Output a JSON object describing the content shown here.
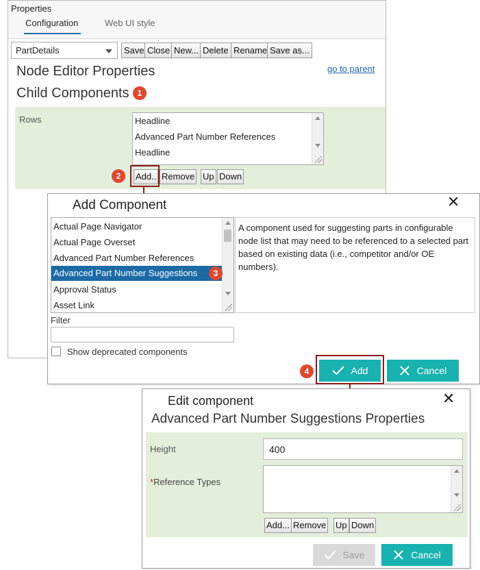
{
  "properties": {
    "title": "Properties",
    "tabs": [
      {
        "label": "Configuration",
        "active": true
      },
      {
        "label": "Web UI style",
        "active": false
      }
    ],
    "toolbar": {
      "select_value": "PartDetails",
      "buttons": [
        "Save",
        "Close",
        "New...",
        "Delete",
        "Rename",
        "Save as..."
      ]
    },
    "heading": "Node Editor Properties",
    "goto_parent": "go to parent",
    "child_heading": "Child Components",
    "rows": {
      "label": "Rows",
      "items": [
        "Headline",
        "Advanced Part Number References",
        "Headline"
      ],
      "buttons": [
        "Add..",
        "Remove",
        "Up",
        "Down"
      ]
    }
  },
  "markers": [
    "1",
    "2",
    "3",
    "4"
  ],
  "add_dialog": {
    "title": "Add Component",
    "close_icon": "close-icon",
    "components": [
      "Actual Page Navigator",
      "Actual Page Overset",
      "Advanced Part Number References",
      "Advanced Part Number Suggestions",
      "Approval Status",
      "Asset Link"
    ],
    "selected_index": 3,
    "description": "A component used for suggesting parts in configurable node list that may need to be referenced to a selected part based on existing data (i.e., competitor and/or OE numbers).",
    "filter_label": "Filter",
    "filter_value": "",
    "deprecated_label": "Show deprecated components",
    "deprecated_checked": false,
    "add_label": "Add",
    "cancel_label": "Cancel"
  },
  "edit_dialog": {
    "title": "Edit component",
    "subtitle": "Advanced Part Number Suggestions Properties",
    "height_label": "Height",
    "height_value": "400",
    "ref_types_required_mark": "*",
    "ref_types_label": "Reference Types",
    "ref_types_buttons": [
      "Add...",
      "Remove",
      "Up",
      "Down"
    ],
    "save_label": "Save",
    "save_enabled": false,
    "cancel_label": "Cancel"
  },
  "colors": {
    "accent_teal": "#18b2b0",
    "selection_blue": "#1b6aa6",
    "marker_red": "#e2472c",
    "callout_darkred": "#8b1a1a",
    "panel_green": "#e3eedb"
  }
}
